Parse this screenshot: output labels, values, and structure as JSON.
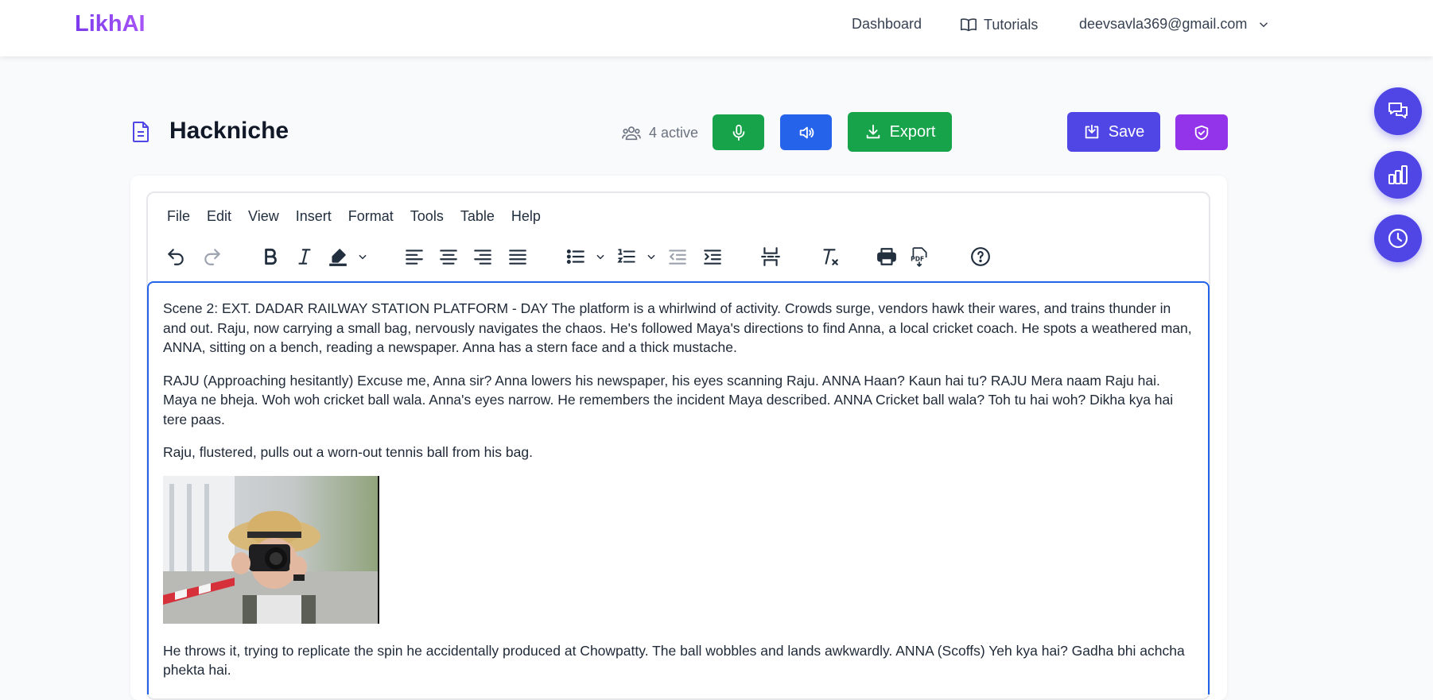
{
  "brand": {
    "name": "LikhAI"
  },
  "nav": {
    "dashboard": "Dashboard",
    "tutorials": "Tutorials",
    "account_email": "deevsavla369@gmail.com"
  },
  "document": {
    "title": "Hackniche",
    "active_users": "4 active"
  },
  "actions": {
    "export_label": "Export",
    "save_label": "Save"
  },
  "editor": {
    "menu": [
      "File",
      "Edit",
      "View",
      "Insert",
      "Format",
      "Tools",
      "Table",
      "Help"
    ],
    "paragraphs": [
      "Scene 2:  EXT. DADAR RAILWAY STATION PLATFORM - DAY  The platform is a whirlwind of activity. Crowds surge, vendors hawk their wares, and trains thunder in and out. Raju, now carrying a small bag, nervously navigates the chaos. He's followed Maya's directions to find Anna, a local cricket coach.  He spots a weathered man, ANNA, sitting on a bench, reading a newspaper. Anna has a stern face and a thick mustache.",
      "RAJU (Approaching hesitantly) Excuse me, Anna sir?  Anna lowers his newspaper, his eyes scanning Raju.  ANNA Haan? Kaun hai tu?  RAJU Mera naam Raju hai. Maya ne bheja. Woh  woh cricket ball wala.  Anna's eyes narrow. He remembers the incident Maya described.  ANNA Cricket ball wala? Toh tu hai woh? Dikha kya hai tere paas.",
      "Raju, flustered, pulls out a worn-out tennis ball from his bag.",
      "He throws it, trying to replicate the spin he accidentally produced at Chowpatty. The ball wobbles and lands awkwardly.  ANNA (Scoffs) Yeh kya hai? Gadha bhi achcha phekta hai."
    ]
  },
  "colors": {
    "brand_purple": "#7c3aed",
    "green": "#16a34a",
    "blue": "#2563eb",
    "indigo": "#4f46e5",
    "purple": "#9333ea"
  }
}
